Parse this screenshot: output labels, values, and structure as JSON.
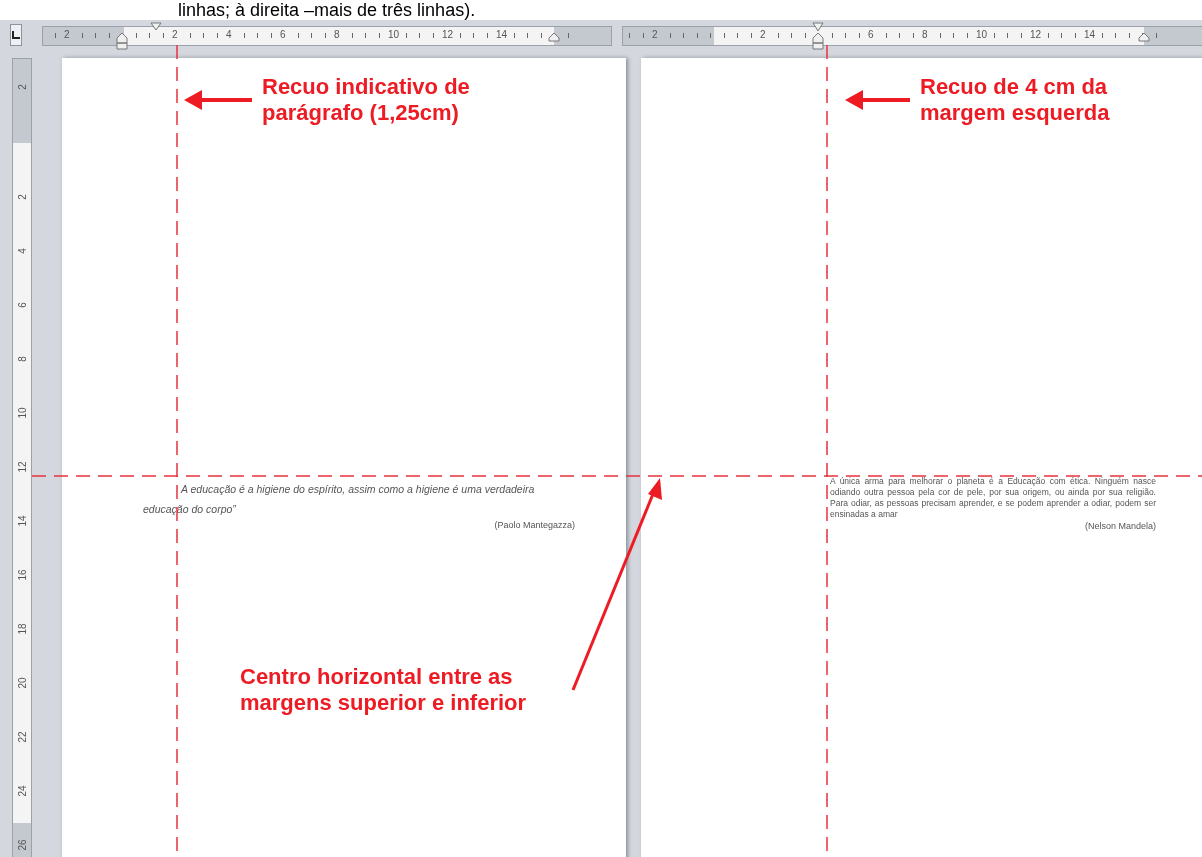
{
  "top_text": "linhas; à direita –mais de três linhas).",
  "rulers": [
    {
      "labels": [
        "2",
        "2",
        "4",
        "6",
        "8",
        "10",
        "12",
        "14"
      ]
    },
    {
      "labels": [
        "2",
        "2",
        "6",
        "8",
        "10",
        "12",
        "14"
      ]
    }
  ],
  "vertical_ruler": {
    "labels": [
      "2",
      "2",
      "4",
      "6",
      "8",
      "10",
      "12",
      "14",
      "16",
      "18",
      "20",
      "22",
      "24",
      "26"
    ]
  },
  "pages": [
    {
      "kind": "paragraph-indent",
      "quote": "A educação é a higiene do espírito, assim como a higiene é uma verdadeira educação do corpo”",
      "author": "(Paolo Mantegazza)"
    },
    {
      "kind": "block-indent",
      "quote": "A única arma para melhorar o planeta é a Educação com ética. Ninguém nasce odiando outra pessoa pela cor de pele, por sua origem, ou ainda por sua religião. Para odiar, as pessoas precisam aprender, e se podem aprender a odiar, podem ser ensinadas a amar",
      "author": "(Nelson Mandela)"
    }
  ],
  "annotations": [
    {
      "lines": [
        "Recuo indicativo de",
        "parágrafo (1,25cm)"
      ]
    },
    {
      "lines": [
        "Recuo de 4 cm da",
        "margem esquerda"
      ]
    },
    {
      "lines": [
        "Centro horizontal entre as",
        "margens superior e inferior"
      ]
    }
  ]
}
